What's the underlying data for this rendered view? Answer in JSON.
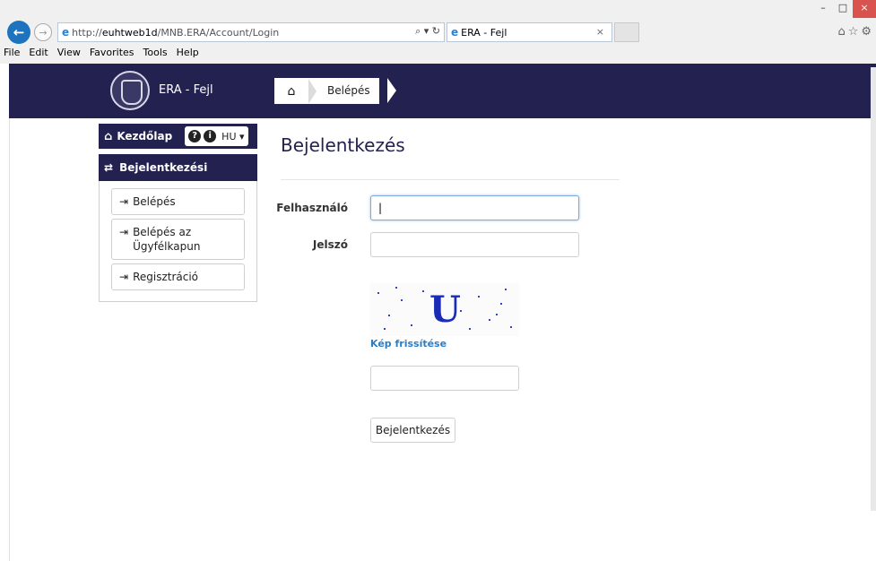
{
  "browser": {
    "address": {
      "prefix": "http://",
      "domain": "euhtweb1d",
      "path": "/MNB.ERA/Account/Login"
    },
    "address_tools": "⌕ ▾ ↻",
    "tab_title": "ERA - Fejl",
    "tab_close": "×",
    "menu": [
      "File",
      "Edit",
      "View",
      "Favorites",
      "Tools",
      "Help"
    ],
    "window_controls": {
      "minimize": "–",
      "maximize": "□",
      "close": "×"
    },
    "right_icons": "⌂☆⚙",
    "icons": {
      "back": "back-arrow-icon",
      "forward": "forward-arrow-icon",
      "ie": "internet-explorer-icon"
    }
  },
  "header": {
    "brand": "ERA - Fejl",
    "breadcrumb": {
      "current": "Belépés"
    },
    "colors": {
      "navy": "#23214f"
    }
  },
  "sidebar": {
    "home_label": "Kezdőlap",
    "help_icon": "?",
    "info_icon": "i",
    "language": "HU ▾",
    "section_label": "Bejelentkezési",
    "items": [
      {
        "label": "Belépés"
      },
      {
        "label": "Belépés az Ügyfélkapun"
      },
      {
        "label": "Regisztráció"
      }
    ]
  },
  "main": {
    "title": "Bejelentkezés",
    "username_label": "Felhasználó",
    "username_value": "|",
    "password_label": "Jelszó",
    "captcha_letter": "U",
    "captcha_refresh": "Kép frissítése",
    "submit_label": "Bejelentkezés",
    "link_color": "#2a7dc6"
  }
}
